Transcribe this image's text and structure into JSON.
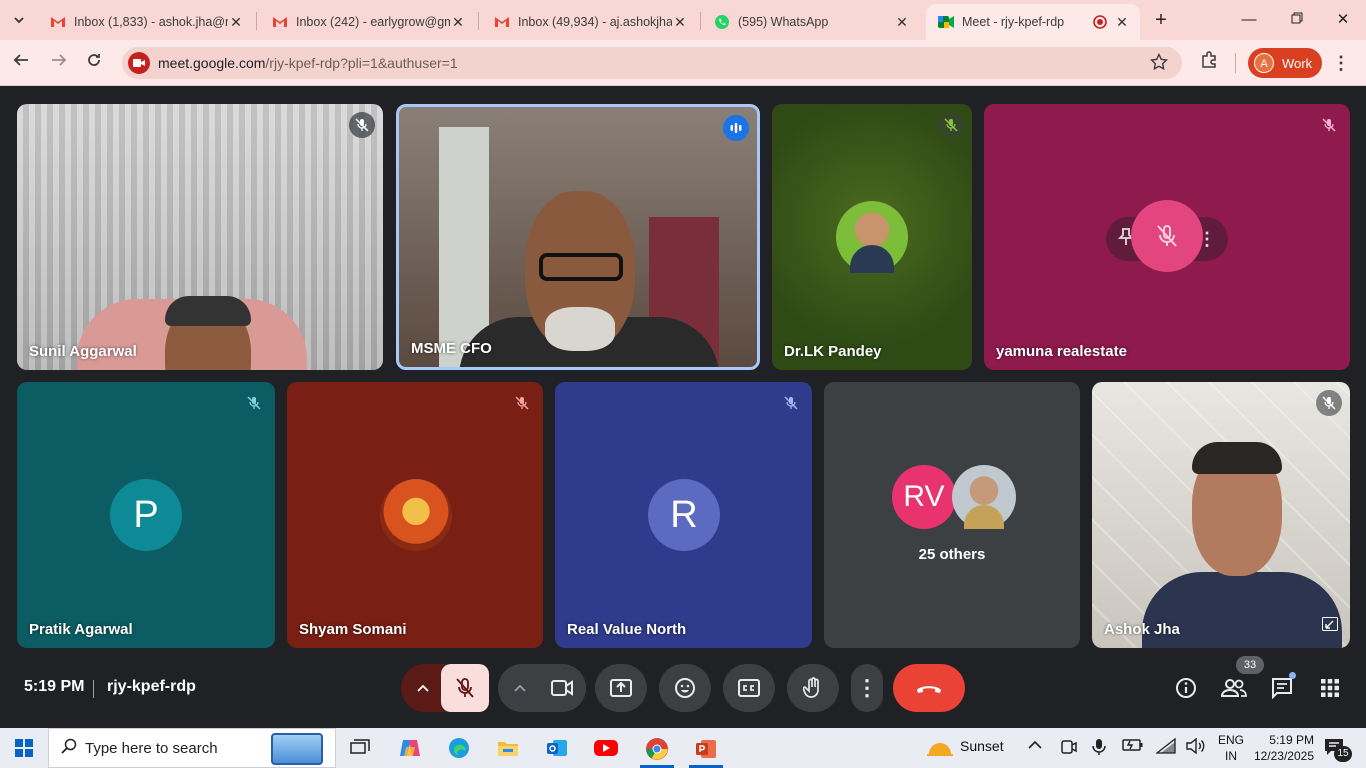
{
  "browser": {
    "tabs": [
      {
        "title": "Inbox (1,833) - ashok.jha@re",
        "icon": "gmail-icon",
        "active": false
      },
      {
        "title": "Inbox (242) - earlygrow@gm",
        "icon": "gmail-icon",
        "active": false
      },
      {
        "title": "Inbox (49,934) - aj.ashokjha@",
        "icon": "gmail-icon",
        "active": false
      },
      {
        "title": "(595) WhatsApp",
        "icon": "whatsapp-icon",
        "active": false
      },
      {
        "title": "Meet - rjy-kpef-rdp",
        "icon": "meet-icon",
        "active": true
      }
    ],
    "url_host": "meet.google.com",
    "url_path": "/rjy-kpef-rdp?pli=1&authuser=1",
    "profile_initial": "A",
    "profile_label": "Work"
  },
  "participants": [
    {
      "name": "Sunil Aggarwal",
      "muted": true,
      "type": "video"
    },
    {
      "name": "MSME CFO",
      "muted": false,
      "type": "video",
      "speaking": true
    },
    {
      "name": "Dr.LK Pandey",
      "muted": true,
      "type": "photo"
    },
    {
      "name": "yamuna realestate",
      "muted": true,
      "type": "hover"
    },
    {
      "name": "Pratik Agarwal",
      "muted": true,
      "type": "letter",
      "letter": "P",
      "color": "#0e8a96"
    },
    {
      "name": "Shyam Somani",
      "muted": true,
      "type": "photo"
    },
    {
      "name": "Real Value North",
      "muted": true,
      "type": "letter",
      "letter": "R",
      "color": "#5c6bc0"
    },
    {
      "name": "25 others",
      "type": "others",
      "avatar_letters": "RV"
    },
    {
      "name": "Ashok Jha",
      "muted": true,
      "type": "video"
    }
  ],
  "meeting": {
    "time": "5:19 PM",
    "code": "rjy-kpef-rdp",
    "participant_count": "33"
  },
  "taskbar": {
    "search_placeholder": "Type here to search",
    "weather": "Sunset",
    "lang_top": "ENG",
    "lang_bottom": "IN",
    "time": "5:19 PM",
    "date": "12/23/2025",
    "notif_count": "15"
  },
  "colors": {
    "tabstrip": "#f8d7d4",
    "toolbar": "#fde9e7",
    "meet_bg": "#202124",
    "end_call": "#ea4335",
    "mic_off": "#f9dedc"
  }
}
